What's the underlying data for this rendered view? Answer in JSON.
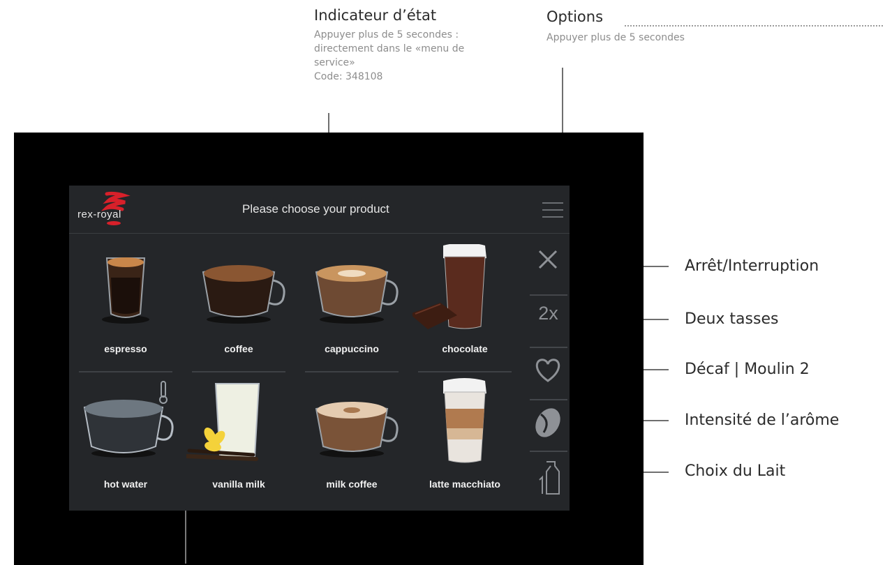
{
  "callouts": {
    "status_indicator": {
      "title": "Indicateur d’état",
      "lines": [
        "Appuyer plus de 5 secondes :",
        "directement dans le «menu de",
        "service»",
        "Code: 348108"
      ]
    },
    "options": {
      "title": "Options",
      "subtitle": "Appuyer plus de 5 secondes"
    },
    "right": [
      "Arrêt/Interruption",
      "Deux tasses",
      "Décaf | Moulin 2",
      "Intensité de l’arôme",
      "Choix du Lait"
    ]
  },
  "screen": {
    "logo_text": "rex-royal",
    "title": "Please choose your product",
    "menu_icon": "hamburger-menu-icon"
  },
  "products": [
    {
      "label": "espresso",
      "icon": "espresso-glass-icon"
    },
    {
      "label": "coffee",
      "icon": "coffee-cup-icon"
    },
    {
      "label": "cappuccino",
      "icon": "cappuccino-cup-icon"
    },
    {
      "label": "chocolate",
      "icon": "chocolate-glass-icon"
    },
    {
      "label": "hot water",
      "icon": "hot-water-cup-icon"
    },
    {
      "label": "vanilla milk",
      "icon": "vanilla-milk-glass-icon"
    },
    {
      "label": "milk coffee",
      "icon": "milk-coffee-cup-icon"
    },
    {
      "label": "latte macchiato",
      "icon": "latte-macchiato-glass-icon"
    }
  ],
  "sidebar": {
    "two_cups_label": "2x",
    "icons": [
      "stop-x-icon",
      "two-cups-icon",
      "heart-icon",
      "coffee-bean-icon",
      "milk-carton-icon"
    ]
  },
  "colors": {
    "screen_bg": "#242629",
    "device_bg": "#000000",
    "logo_red": "#d8202a",
    "icon_gray": "#8e9196"
  }
}
